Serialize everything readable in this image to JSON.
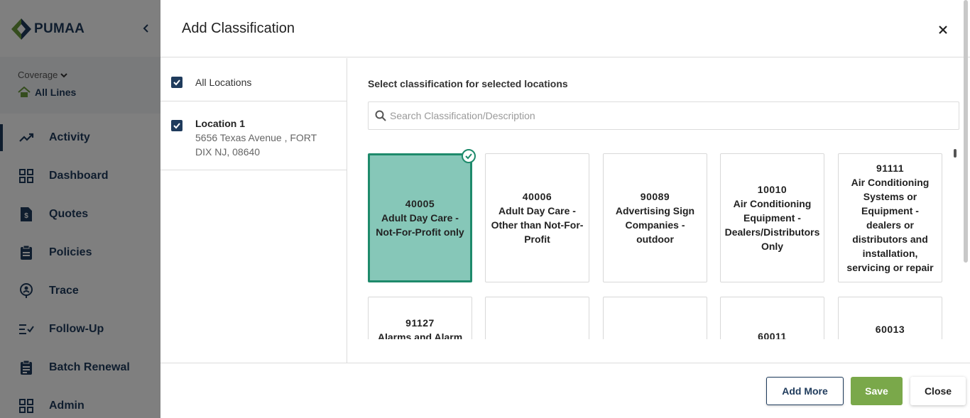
{
  "app": {
    "logo_text": "PUMAA",
    "coverage_label": "Coverage",
    "coverage_value": "All Lines"
  },
  "nav": {
    "items": [
      {
        "label": "Activity",
        "icon": "trending-up-icon"
      },
      {
        "label": "Dashboard",
        "icon": "grid-icon"
      },
      {
        "label": "Quotes",
        "icon": "dollar-document-icon"
      },
      {
        "label": "Policies",
        "icon": "clipboard-icon"
      },
      {
        "label": "Trace",
        "icon": "location-person-icon"
      },
      {
        "label": "Follow-Up",
        "icon": "list-check-icon"
      },
      {
        "label": "Batch Renewal",
        "icon": "clipboard-list-icon"
      },
      {
        "label": "Admin",
        "icon": "grid-icon"
      }
    ]
  },
  "modal": {
    "title": "Add Classification",
    "locations": {
      "all_label": "All Locations",
      "items": [
        {
          "name": "Location 1",
          "address": "5656 Texas Avenue , FORT DIX NJ, 08640"
        }
      ]
    },
    "classification_title": "Select classification for selected locations",
    "search_placeholder": "Search Classification/Description",
    "cards": [
      {
        "code": "40005",
        "desc": "Adult Day Care - Not-For-Profit only",
        "selected": true
      },
      {
        "code": "40006",
        "desc": "Adult Day Care - Other than Not-For-Profit",
        "selected": false
      },
      {
        "code": "90089",
        "desc": "Advertising Sign Companies - outdoor",
        "selected": false
      },
      {
        "code": "10010",
        "desc": "Air Conditioning Equipment - Dealers/Distributors Only",
        "selected": false
      },
      {
        "code": "91111",
        "desc": "Air Conditioning Systems or Equipment - dealers or distributors and installation, servicing or repair",
        "selected": false
      },
      {
        "code": "91127",
        "desc": "Alarms and Alarm",
        "selected": false
      },
      {
        "code": "",
        "desc": "",
        "selected": false
      },
      {
        "code": "",
        "desc": "",
        "selected": false
      },
      {
        "code": "60011",
        "desc": "",
        "selected": false
      },
      {
        "code": "60013",
        "desc": "",
        "selected": false
      }
    ],
    "buttons": {
      "add_more": "Add More",
      "save": "Save",
      "close": "Close"
    },
    "colors": {
      "selected_fill": "#86c7b8",
      "selected_border": "#1e8a6b",
      "save_button": "#7aa84a",
      "brand_navy": "#1f3b5c"
    }
  }
}
